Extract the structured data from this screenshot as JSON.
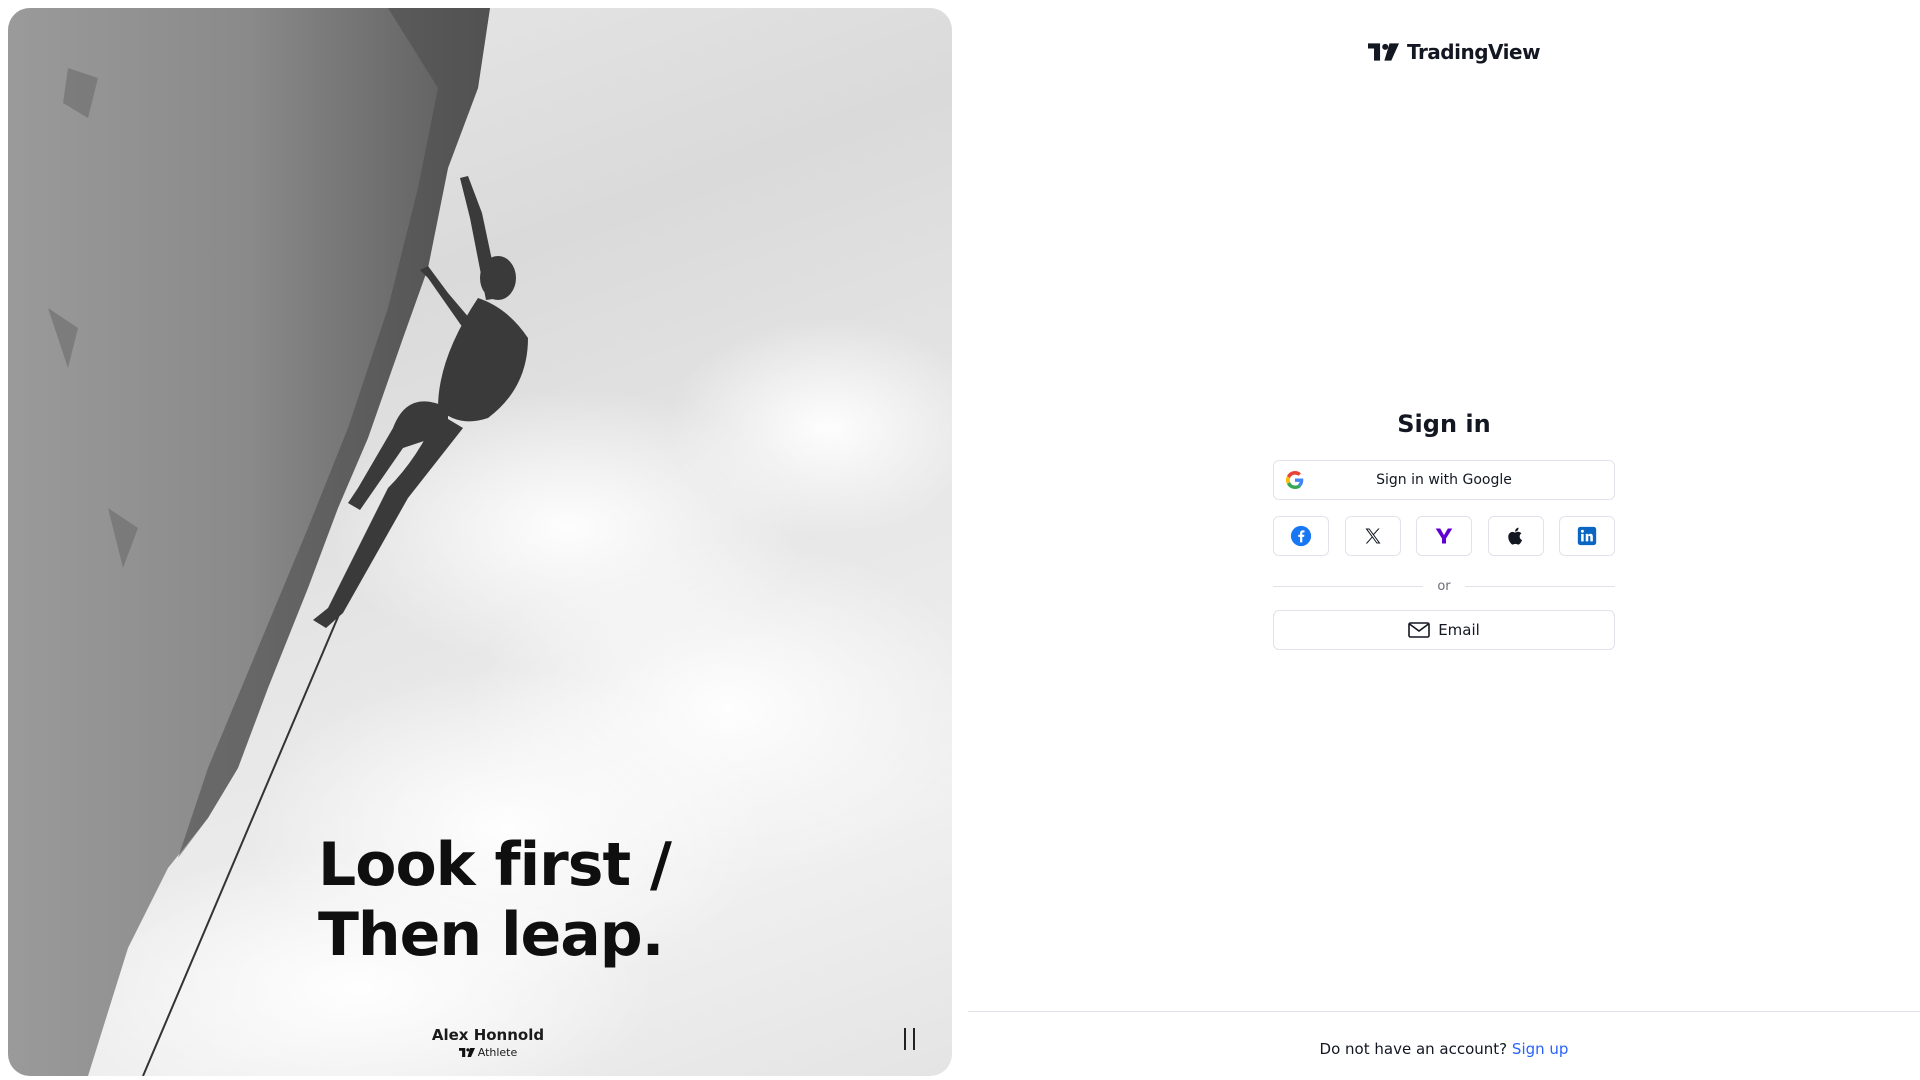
{
  "hero": {
    "headline_line1": "Look first /",
    "headline_line2": "Then leap.",
    "athlete_name": "Alex Honnold",
    "athlete_role": "Athlete",
    "pause_icon": "pause-icon"
  },
  "brand": {
    "name": "TradingView",
    "logo_icon": "tradingview-logo-icon"
  },
  "signin": {
    "title": "Sign in",
    "google_label": "Sign in with Google",
    "socials": [
      "facebook-icon",
      "x-icon",
      "yahoo-icon",
      "apple-icon",
      "linkedin-icon"
    ],
    "divider_text": "or",
    "email_label": "Email"
  },
  "footer": {
    "prompt": "Do not have an account?",
    "link": "Sign up"
  },
  "colors": {
    "link": "#2962ff",
    "border": "#e0e3eb",
    "text": "#131722",
    "facebook": "#1877f2",
    "yahoo": "#6001d2",
    "linkedin": "#0a66c2"
  }
}
